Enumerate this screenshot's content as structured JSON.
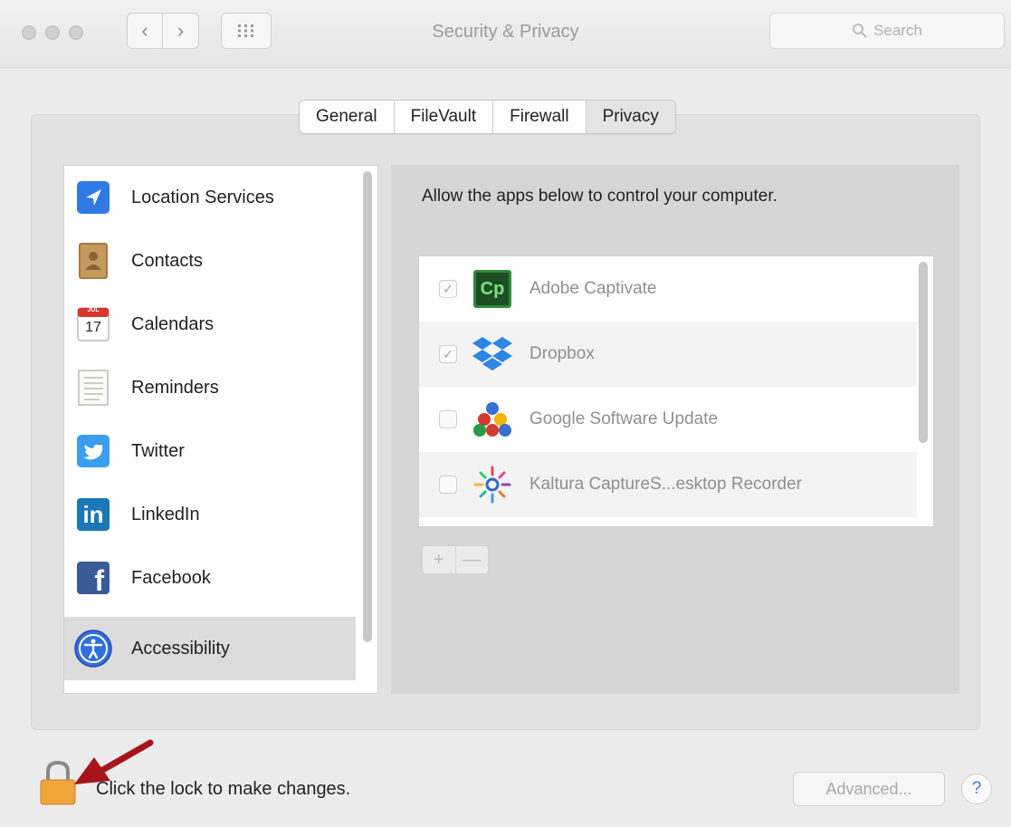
{
  "window": {
    "title": "Security & Privacy",
    "back_glyph": "‹",
    "forward_glyph": "›",
    "search_placeholder": "Search"
  },
  "tabs": [
    {
      "label": "General",
      "active": false
    },
    {
      "label": "FileVault",
      "active": false
    },
    {
      "label": "Firewall",
      "active": false
    },
    {
      "label": "Privacy",
      "active": true
    }
  ],
  "sidebar": {
    "items": [
      {
        "label": "Location Services",
        "icon": "location-arrow-icon"
      },
      {
        "label": "Contacts",
        "icon": "contacts-book-icon"
      },
      {
        "label": "Calendars",
        "icon": "calendar-icon",
        "icon_text": "17",
        "icon_header": "JUL"
      },
      {
        "label": "Reminders",
        "icon": "reminders-list-icon"
      },
      {
        "label": "Twitter",
        "icon": "twitter-bird-icon"
      },
      {
        "label": "LinkedIn",
        "icon": "linkedin-logo-icon",
        "icon_text": "in"
      },
      {
        "label": "Facebook",
        "icon": "facebook-logo-icon",
        "icon_text": "f"
      },
      {
        "label": "Accessibility",
        "icon": "accessibility-icon",
        "selected": true
      }
    ]
  },
  "privacy_pane": {
    "description": "Allow the apps below to control your computer.",
    "apps": [
      {
        "name": "Adobe Captivate",
        "checked": true,
        "icon": "adobe-captivate-icon",
        "icon_text": "Cp"
      },
      {
        "name": "Dropbox",
        "checked": true,
        "icon": "dropbox-icon"
      },
      {
        "name": "Google Software Update",
        "checked": false,
        "icon": "google-software-update-icon"
      },
      {
        "name": "Kaltura CaptureS...esktop Recorder",
        "checked": false,
        "icon": "kaltura-capture-icon"
      }
    ],
    "add_glyph": "+",
    "remove_glyph": "—",
    "check_glyph": "✓"
  },
  "footer": {
    "lock_text": "Click the lock to make changes.",
    "advanced_label": "Advanced...",
    "help_label": "?"
  },
  "colors": {
    "arrow": "#a5161b",
    "lock_body": "#f0a43a",
    "accent_blue": "#2f7ae5"
  }
}
